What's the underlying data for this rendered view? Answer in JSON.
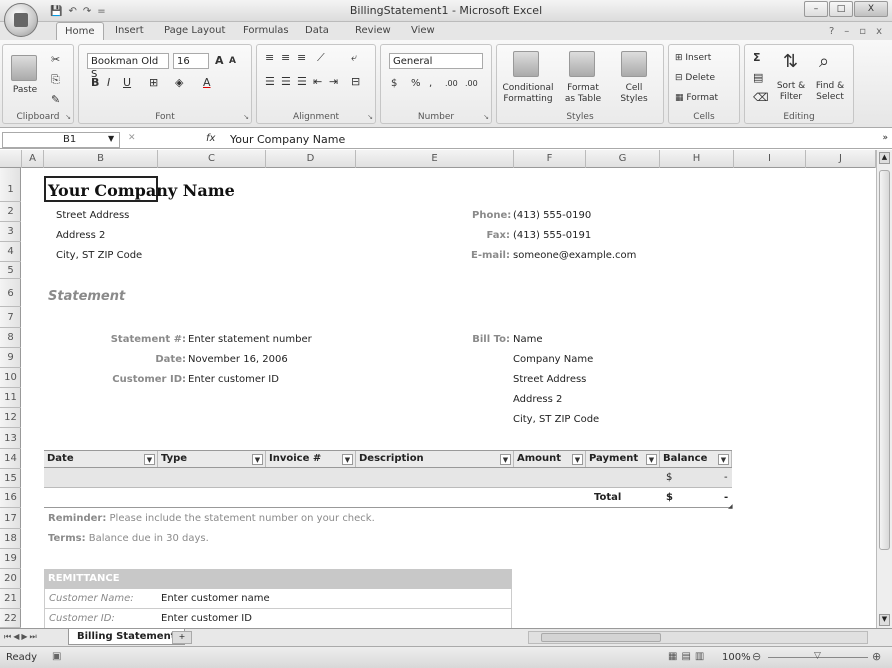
{
  "window": {
    "title": "BillingStatement1 - Microsoft Excel",
    "min": "–",
    "max": "□",
    "close": "X"
  },
  "qat": {
    "save": "💾",
    "undo": "↶",
    "redo": "↷",
    "more": "="
  },
  "tabs": [
    "Home",
    "Insert",
    "Page Layout",
    "Formulas",
    "Data",
    "Review",
    "View"
  ],
  "ribbon": {
    "clipboard": {
      "label": "Clipboard",
      "paste": "Paste"
    },
    "font": {
      "label": "Font",
      "name": "Bookman Old S",
      "size": "16",
      "grow": "A",
      "shrink": "A",
      "bold": "B",
      "italic": "I",
      "underline": "U",
      "fontcolor": "A"
    },
    "alignment": {
      "label": "Alignment"
    },
    "number": {
      "label": "Number",
      "format": "General",
      "currency": "$",
      "percent": "%",
      "comma": ",",
      "inc": ".00",
      "dec": ".00"
    },
    "styles": {
      "label": "Styles",
      "cond1": "Conditional",
      "cond2": "Formatting",
      "fmt1": "Format",
      "fmt2": "as Table",
      "cell1": "Cell",
      "cell2": "Styles"
    },
    "cells": {
      "label": "Cells",
      "insert": "Insert",
      "delete": "Delete",
      "format": "Format"
    },
    "editing": {
      "label": "Editing",
      "sort1": "Sort &",
      "sort2": "Filter",
      "find1": "Find &",
      "find2": "Select"
    }
  },
  "formula": {
    "namebox": "B1",
    "fx": "fx",
    "value": "Your Company Name"
  },
  "columns": [
    "A",
    "B",
    "C",
    "D",
    "E",
    "F",
    "G",
    "H",
    "I",
    "J"
  ],
  "rows": [
    "1",
    "2",
    "3",
    "4",
    "5",
    "6",
    "7",
    "8",
    "9",
    "10",
    "11",
    "12",
    "13",
    "14",
    "15",
    "16",
    "17",
    "18",
    "19",
    "20",
    "21",
    "22"
  ],
  "company": {
    "name": "Your Company Name",
    "street": "Street Address",
    "address2": "Address 2",
    "city": "City, ST  ZIP Code",
    "phone_label": "Phone:",
    "phone": "(413) 555-0190",
    "fax_label": "Fax:",
    "fax": "(413) 555-0191",
    "email_label": "E-mail:",
    "email": "someone@example.com"
  },
  "statement": {
    "heading": "Statement",
    "num_label": "Statement #:",
    "num": "Enter statement number",
    "date_label": "Date:",
    "date": "November 16, 2006",
    "cust_label": "Customer ID:",
    "cust": "Enter customer ID"
  },
  "billto": {
    "label": "Bill To:",
    "name": "Name",
    "company": "Company Name",
    "street": "Street Address",
    "address2": "Address 2",
    "city": "City, ST  ZIP Code"
  },
  "table": {
    "headers": [
      "Date",
      "Type",
      "Invoice #",
      "Description",
      "Amount",
      "Payment",
      "Balance"
    ],
    "row1_balance_sym": "$",
    "row1_balance": "-",
    "total_label": "Total",
    "total_sym": "$",
    "total": "-"
  },
  "notes": {
    "reminder_label": "Reminder:",
    "reminder": "Please include the statement number on your check.",
    "terms_label": "Terms:",
    "terms": "Balance due in 30 days."
  },
  "remittance": {
    "heading": "REMITTANCE",
    "name_label": "Customer Name:",
    "name": "Enter customer name",
    "id_label": "Customer ID:",
    "id": "Enter customer ID"
  },
  "sheettab": "Billing Statement",
  "status": {
    "ready": "Ready",
    "zoom": "100%"
  }
}
